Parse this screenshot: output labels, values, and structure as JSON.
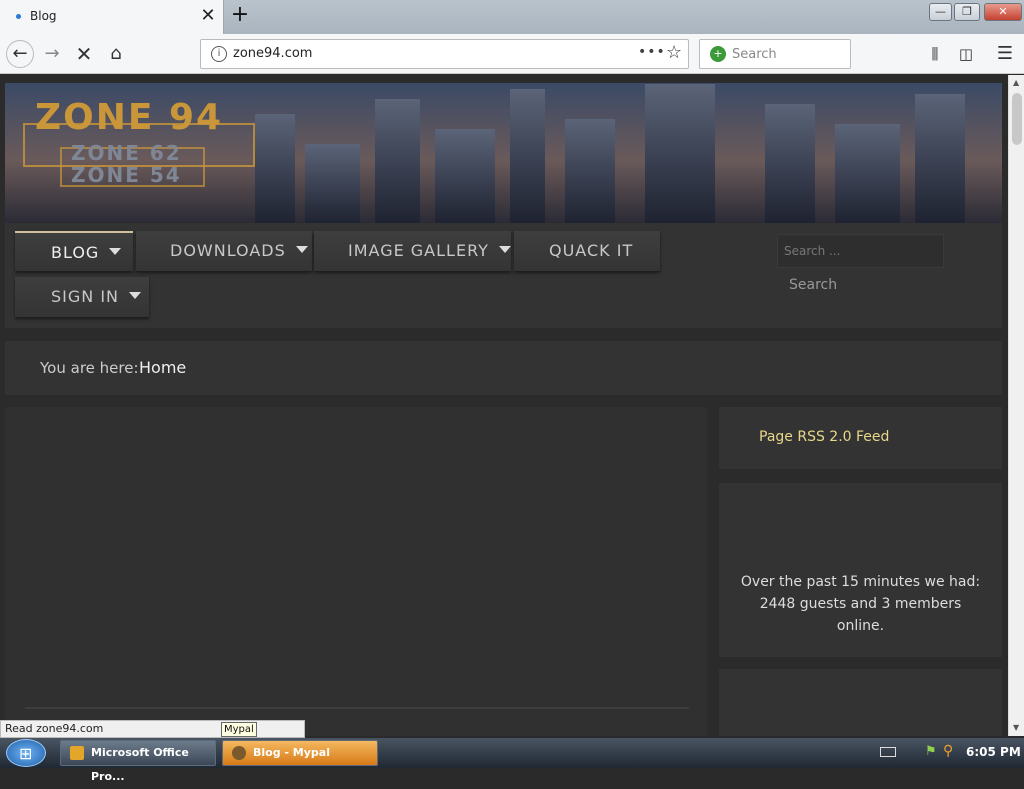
{
  "browser": {
    "tab_title": "Blog",
    "tab_close": "✕",
    "new_tab": "+",
    "url": "zone94.com",
    "page_actions": "•••",
    "search_placeholder": "Search",
    "window_buttons": {
      "minimize": "—",
      "maximize": "❐",
      "close": "✕"
    }
  },
  "site": {
    "logo": {
      "main": "ZONE 94",
      "sub1": "ZONE 62",
      "sub2": "ZONE 54"
    },
    "menu": [
      {
        "label": "BLOG",
        "dropdown": true
      },
      {
        "label": "DOWNLOADS",
        "dropdown": true
      },
      {
        "label": "IMAGE GALLERY",
        "dropdown": true
      },
      {
        "label": "QUACK IT",
        "dropdown": false
      },
      {
        "label": "SIGN IN",
        "dropdown": true
      }
    ],
    "search": {
      "placeholder": "Search ...",
      "button_label": "Search"
    },
    "breadcrumb": {
      "prefix": "You are here:",
      "current": "Home"
    },
    "sidebar": {
      "rss_link": "Page RSS 2.0 Feed",
      "online_text": "Over the past 15 minutes we had: 2448 guests and 3 members online."
    }
  },
  "status_bar": {
    "text": "Read zone94.com",
    "tooltip": "Mypal"
  },
  "taskbar": {
    "items": [
      {
        "label": "Microsoft Office Pro..."
      },
      {
        "label": "Blog - Mypal"
      }
    ],
    "clock": "6:05 PM"
  },
  "colors": {
    "accent_gold": "#c9963a",
    "rss_link": "#e8d78a",
    "active_task": "#f4b860"
  }
}
